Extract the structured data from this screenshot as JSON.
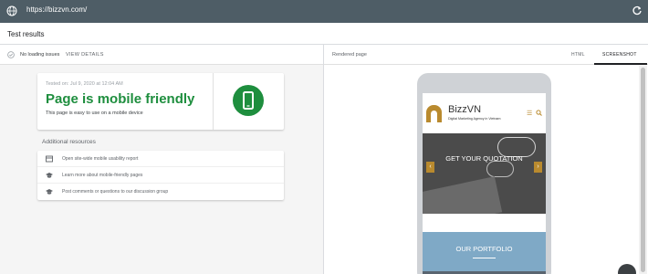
{
  "browser": {
    "url": "https://bizzvn.com/",
    "globe_icon": "globe-icon",
    "refresh_icon": "refresh-icon"
  },
  "header": {
    "title": "Test results"
  },
  "left": {
    "status": "No loading issues",
    "view_details": "VIEW DETAILS",
    "card": {
      "tested_on": "Tested on: Jul 9, 2020 at 12:04 AM",
      "headline": "Page is mobile friendly",
      "description": "This page is easy to use on a mobile device",
      "accent": "#1e8e3e"
    },
    "additional_title": "Additional resources",
    "resources": [
      {
        "label": "Open site-wide mobile usability report",
        "icon": "report-icon"
      },
      {
        "label": "Learn more about mobile-friendly pages",
        "icon": "graduation-cap-icon"
      },
      {
        "label": "Post comments or questions to our discussion group",
        "icon": "graduation-cap-icon"
      }
    ]
  },
  "right": {
    "rendered_label": "Rendered page",
    "tabs": [
      {
        "label": "HTML",
        "selected": false
      },
      {
        "label": "SCREENSHOT",
        "selected": true
      }
    ],
    "site": {
      "name": "BizzVN",
      "tagline": "Digital Marketing Agency in Vietnam",
      "slider_caption": "GET YOUR QUOTATION",
      "prev_arrow": "‹",
      "next_arrow": "›",
      "portfolio_title": "OUR PORTFOLIO",
      "brand_color": "#b98a2e"
    }
  }
}
